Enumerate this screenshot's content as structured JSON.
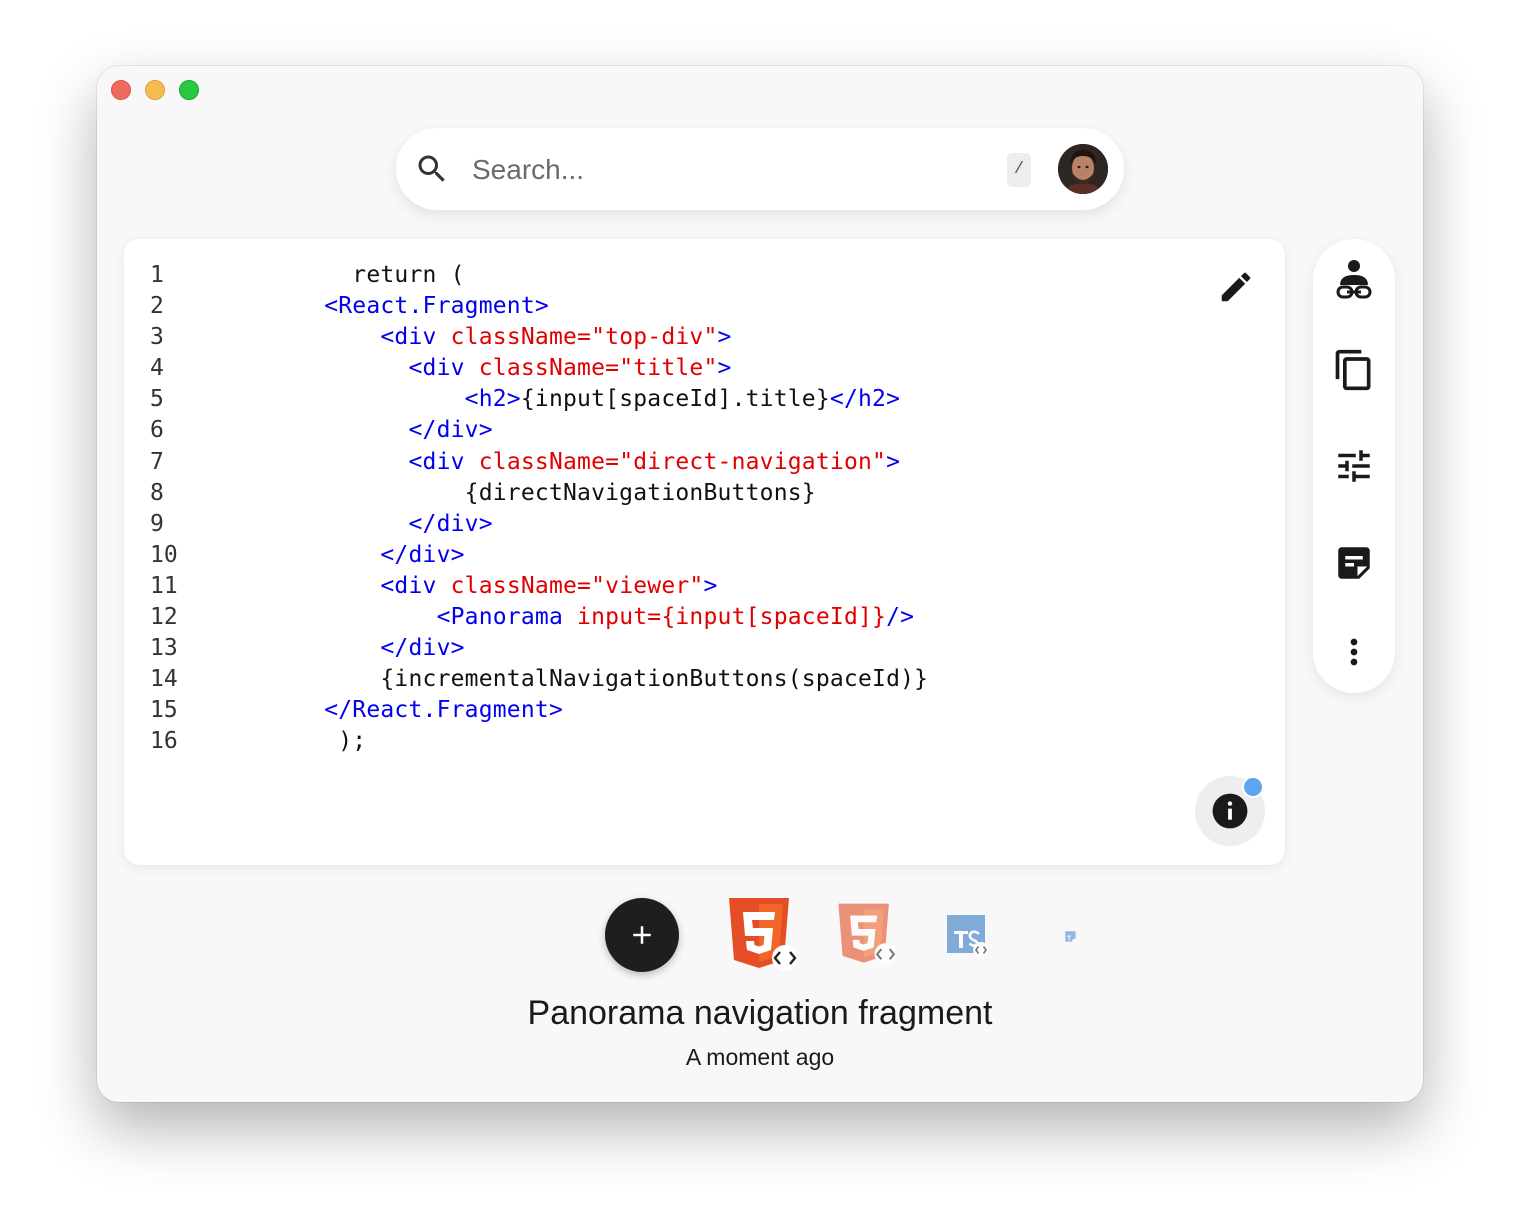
{
  "window": {
    "controls": [
      "close",
      "minimize",
      "zoom"
    ]
  },
  "search": {
    "placeholder": "Search...",
    "shortcut": "/",
    "icon": "search-icon",
    "avatar": "user-avatar"
  },
  "editor": {
    "lines": [
      {
        "no": "1",
        "tokens": [
          {
            "t": "      return (",
            "c": "plain"
          }
        ]
      },
      {
        "no": "2",
        "tokens": [
          {
            "t": "    <React.Fragment>",
            "c": "tag"
          }
        ]
      },
      {
        "no": "3",
        "tokens": [
          {
            "t": "        <div ",
            "c": "tag"
          },
          {
            "t": "className=\"top-div\"",
            "c": "attr"
          },
          {
            "t": ">",
            "c": "tag"
          }
        ]
      },
      {
        "no": "4",
        "tokens": [
          {
            "t": "          <div ",
            "c": "tag"
          },
          {
            "t": "className=\"title\"",
            "c": "attr"
          },
          {
            "t": ">",
            "c": "tag"
          }
        ]
      },
      {
        "no": "5",
        "tokens": [
          {
            "t": "              <h2>",
            "c": "tag"
          },
          {
            "t": "{input[spaceId].title}",
            "c": "plain"
          },
          {
            "t": "</h2>",
            "c": "tag"
          }
        ]
      },
      {
        "no": "6",
        "tokens": [
          {
            "t": "          </div>",
            "c": "tag"
          }
        ]
      },
      {
        "no": "7",
        "tokens": [
          {
            "t": "          <div ",
            "c": "tag"
          },
          {
            "t": "className=\"direct-navigation\"",
            "c": "attr"
          },
          {
            "t": ">",
            "c": "tag"
          }
        ]
      },
      {
        "no": "8",
        "tokens": [
          {
            "t": "              {directNavigationButtons}",
            "c": "plain"
          }
        ]
      },
      {
        "no": "9",
        "tokens": [
          {
            "t": "          </div>",
            "c": "tag"
          }
        ]
      },
      {
        "no": "10",
        "tokens": [
          {
            "t": "        </div>",
            "c": "tag"
          }
        ]
      },
      {
        "no": "11",
        "tokens": [
          {
            "t": "        <div ",
            "c": "tag"
          },
          {
            "t": "className=\"viewer\"",
            "c": "attr"
          },
          {
            "t": ">",
            "c": "tag"
          }
        ]
      },
      {
        "no": "12",
        "tokens": [
          {
            "t": "            <Panorama ",
            "c": "tag"
          },
          {
            "t": "input={input[spaceId]}",
            "c": "attr"
          },
          {
            "t": "/>",
            "c": "tag"
          }
        ]
      },
      {
        "no": "13",
        "tokens": [
          {
            "t": "        </div>",
            "c": "tag"
          }
        ]
      },
      {
        "no": "14",
        "tokens": [
          {
            "t": "        {incrementalNavigationButtons(spaceId)}",
            "c": "plain"
          }
        ]
      },
      {
        "no": "15",
        "tokens": [
          {
            "t": "    </React.Fragment>",
            "c": "tag"
          }
        ]
      },
      {
        "no": "16",
        "tokens": [
          {
            "t": "     );",
            "c": "plain"
          }
        ]
      }
    ],
    "edit_icon": "pencil-icon",
    "info_icon": "info-icon"
  },
  "toolbar": {
    "tools": [
      "share-link-icon",
      "copy-icon",
      "tune-icon",
      "note-icon",
      "more-vert-icon"
    ]
  },
  "files": [
    {
      "kind": "html5-icon",
      "opacity": 1.0
    },
    {
      "kind": "html5-icon",
      "opacity": 0.6
    },
    {
      "kind": "typescript-icon",
      "opacity": 0.6
    },
    {
      "kind": "typescript-icon",
      "opacity": 0.5
    }
  ],
  "snippet": {
    "title": "Panorama navigation fragment",
    "time": "A moment ago"
  },
  "colors": {
    "tag": "#0000ee",
    "attr": "#e00000",
    "plain": "#111111",
    "html_orange": "#e44d26",
    "ts_blue": "#3178c6",
    "badge_blue": "#5fa4ee"
  }
}
